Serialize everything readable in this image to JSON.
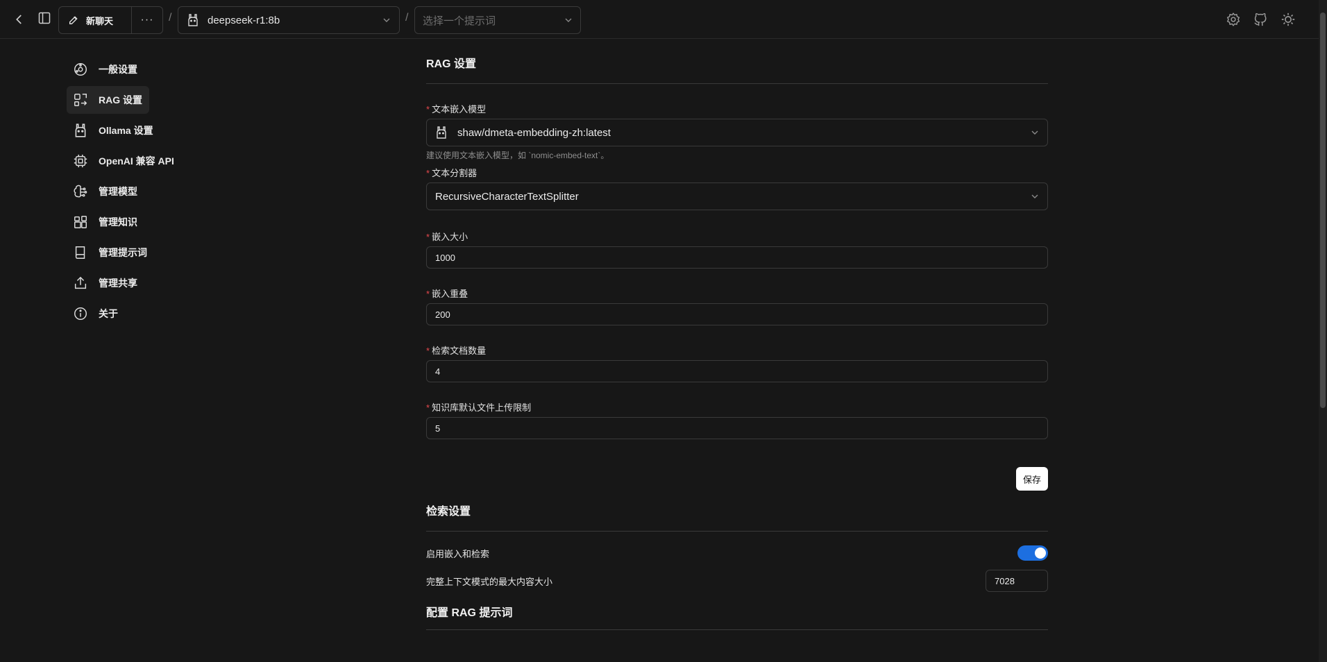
{
  "topbar": {
    "new_chat_label": "新聊天",
    "more_label": "···",
    "separator": "/",
    "model_label": "deepseek-r1:8b",
    "prompt_placeholder": "选择一个提示词"
  },
  "sidebar": {
    "items": [
      {
        "label": "一般设置",
        "icon": "general-settings-icon"
      },
      {
        "label": "RAG 设置",
        "icon": "rag-icon"
      },
      {
        "label": "Ollama 设置",
        "icon": "ollama-llama-icon"
      },
      {
        "label": "OpenAI 兼容 API",
        "icon": "cpu-chip-icon"
      },
      {
        "label": "管理模型",
        "icon": "brain-icon"
      },
      {
        "label": "管理知识",
        "icon": "blocks-icon"
      },
      {
        "label": "管理提示词",
        "icon": "book-icon"
      },
      {
        "label": "管理共享",
        "icon": "share-upload-icon"
      },
      {
        "label": "关于",
        "icon": "info-icon"
      }
    ],
    "active_index": 1
  },
  "rag": {
    "title": "RAG 设置",
    "embedding_model": {
      "label": "文本嵌入模型",
      "value": "shaw/dmeta-embedding-zh:latest",
      "hint": "建议使用文本嵌入模型，如 `nomic-embed-text`。"
    },
    "splitter": {
      "label": "文本分割器",
      "value": "RecursiveCharacterTextSplitter"
    },
    "chunk_size": {
      "label": "嵌入大小",
      "value": "1000"
    },
    "chunk_overlap": {
      "label": "嵌入重叠",
      "value": "200"
    },
    "top_k": {
      "label": "检索文档数量",
      "value": "4"
    },
    "upload_limit": {
      "label": "知识库默认文件上传限制",
      "value": "5"
    },
    "required_mark": "*",
    "save_label": "保存"
  },
  "retrieval": {
    "title": "检索设置",
    "enable_label": "启用嵌入和检索",
    "enable_on": true,
    "max_context_label": "完整上下文模式的最大内容大小",
    "max_context_value": "7028"
  },
  "rag_prompt": {
    "title": "配置 RAG 提示词"
  },
  "colors": {
    "background": "#171717",
    "toggle_on": "#1d6fe0",
    "required": "#e5484d"
  }
}
